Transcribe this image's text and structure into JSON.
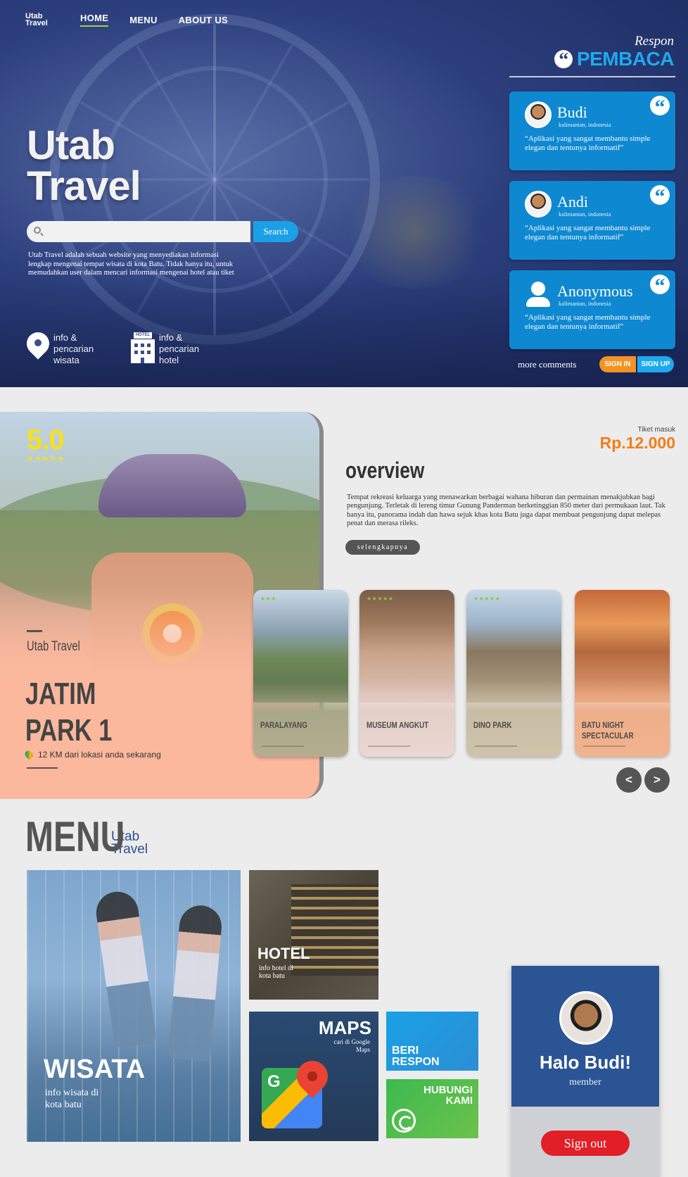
{
  "nav": {
    "logo_line1": "Utab",
    "logo_line2": "Travel",
    "items": [
      "HOME",
      "MENU",
      "ABOUT US"
    ]
  },
  "hero": {
    "title_line1": "Utab",
    "title_line2": "Travel",
    "search_placeholder": "",
    "search_button": "Search",
    "description": "Utab Travel adalah sebuah website yang menyediakan informasi lengkap mengenai tempat wisata di kota Batu. Tidak hanya itu, untuk memudahkan user dalam mencari informasi mengenai hotel atau tiket",
    "features": [
      {
        "icon": "location-pin-icon",
        "label": "info & pencarian wisata"
      },
      {
        "icon": "hotel-icon",
        "label": "info & pencarian hotel"
      }
    ]
  },
  "respon": {
    "small": "Respon",
    "big": "PEMBACA",
    "testimonials": [
      {
        "name": "Budi",
        "location": "kalimantan, indonesia",
        "message": "“Aplikasi yang sangat membantu simple elegan dan tentunya informatif”"
      },
      {
        "name": "Andi",
        "location": "kalimantan, indonesia",
        "message": "“Aplikasi yang sangat membantu simple elegan dan tentunya informatif”"
      },
      {
        "name": "Anonymous",
        "location": "kalimantan, indonesia",
        "message": "“Aplikasi yang sangat membantu simple elegan dan tentunya informatif”"
      }
    ],
    "more": "more comments",
    "sign_in": "SIGN IN",
    "sign_up": "SIGN UP"
  },
  "featured": {
    "rating": "5.0",
    "stars": "★★★★★",
    "brand": "Utab Travel",
    "title_line1": "JATIM",
    "title_line2": "PARK 1",
    "distance": "12 KM dari lokasi anda sekarang"
  },
  "overview": {
    "ticket_label": "Tiket masuk",
    "ticket_price": "Rp.12.000",
    "title": "overview",
    "text": "Tempat rekreasi keluarga yang menawarkan berbagai wahana hiburan dan permainan menakjubkan bagi pengunjung. Terletak di lereng timur Gunung Panderman berketinggian 850 meter dari permukaan laut. Tak hanya itu, panorama indah dan hawa sejuk khas kota Batu juga dapat membuat pengunjung dapat melepas penat dan merasa rileks.",
    "more_button": "selengkapnya"
  },
  "destinations": [
    {
      "name": "PARALAYANG",
      "stars": "★★★",
      "color": "#8aa07a"
    },
    {
      "name": "MUSEUM ANGKUT",
      "stars": "★★★★★",
      "color": "#c9b5ae"
    },
    {
      "name": "DINO PARK",
      "stars": "★★★★★",
      "color": "#b8ad98"
    },
    {
      "name": "BATU NIGHT SPECTACULAR",
      "stars": "",
      "color": "#e89a6a"
    }
  ],
  "carousel": {
    "prev": "<",
    "next": ">"
  },
  "menu": {
    "title": "MENU",
    "sub_line1": "Utab",
    "sub_line2": "Travel",
    "wisata": {
      "title": "WISATA",
      "desc": "info wisata di kota batu"
    },
    "hotel": {
      "title": "HOTEL",
      "desc": "info hotel di kota batu"
    },
    "maps": {
      "title": "MAPS",
      "desc": "cari di Google Maps"
    },
    "respon": {
      "title": "BERI RESPON"
    },
    "hubungi": {
      "title": "HUBUNGI KAMI"
    }
  },
  "profile": {
    "greeting": "Halo Budi!",
    "role": "member",
    "sign_out": "Sign out"
  }
}
